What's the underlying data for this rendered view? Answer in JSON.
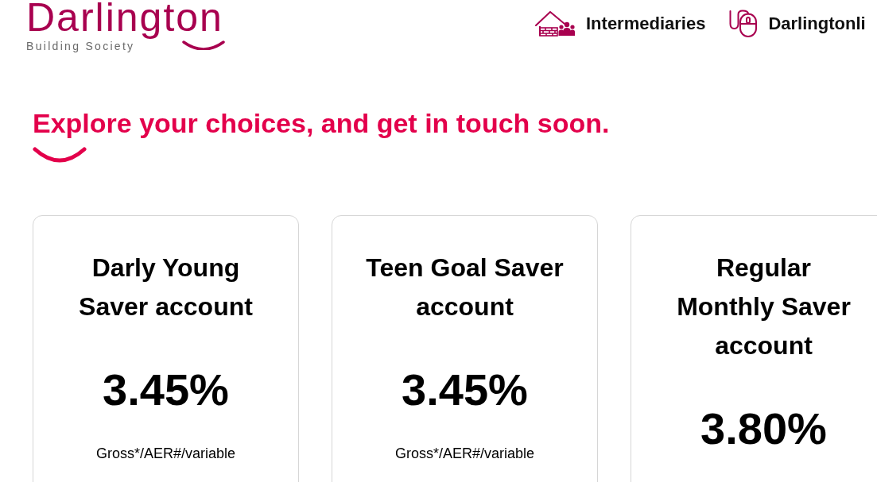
{
  "header": {
    "logo": {
      "name": "Darlington",
      "tagline": "Building Society"
    },
    "nav": [
      {
        "kind": "intermediaries",
        "label": "Intermediaries"
      },
      {
        "kind": "online",
        "label": "Darlingtonli"
      }
    ]
  },
  "heading": "Explore your choices, and get in touch soon.",
  "accounts": [
    {
      "title": "Darly Young\nSaver account",
      "rate": "3.45%",
      "rate_terms": "Gross*/AER#/variable"
    },
    {
      "title": "Teen Goal Saver\naccount",
      "rate": "3.45%",
      "rate_terms": "Gross*/AER#/variable"
    },
    {
      "title": "Regular\nMonthly Saver\naccount",
      "rate": "3.80%"
    }
  ]
}
